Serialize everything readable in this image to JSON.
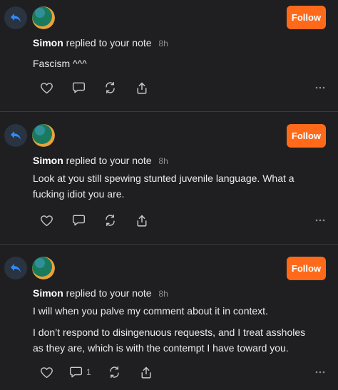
{
  "notes": [
    {
      "author": "Simon",
      "action_text": "replied to your note",
      "time": "8h",
      "follow_label": "Follow",
      "paragraphs": [
        "Fascism ^^^"
      ],
      "comment_count": ""
    },
    {
      "author": "Simon",
      "action_text": "replied to your note",
      "time": "8h",
      "follow_label": "Follow",
      "paragraphs": [
        "Look at you still spewing stunted juvenile language. What a fucking idiot you are."
      ],
      "comment_count": ""
    },
    {
      "author": "Simon",
      "action_text": "replied to your note",
      "time": "8h",
      "follow_label": "Follow",
      "paragraphs": [
        "I will when you palve my comment about it in context.",
        "I don’t respond to disingenuous requests, and I treat assholes as they are, which is with the contempt I have toward you."
      ],
      "comment_count": "1"
    }
  ],
  "icons": {
    "reply_badge": "reply-arrow-icon",
    "like": "heart-icon",
    "comment": "comment-bubble-icon",
    "restack": "restack-icon",
    "share": "share-icon",
    "more": "more-dots-icon"
  },
  "colors": {
    "background": "#1f1f21",
    "follow_button": "#ff6a1a",
    "reply_arrow": "#2d8cff",
    "reply_badge_bg": "#2a3340",
    "divider": "#3a3a3d"
  }
}
